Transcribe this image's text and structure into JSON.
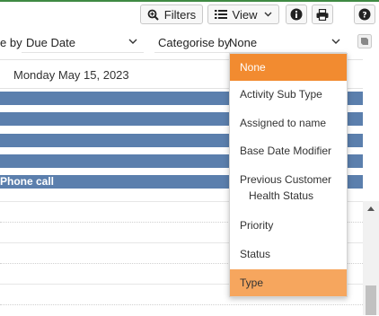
{
  "toolbar": {
    "filters_label": "Filters",
    "view_label": "View"
  },
  "controls": {
    "sort_prefix": "e by",
    "sort_value": "Due Date",
    "categorise_label": "Categorise by",
    "categorise_value": "None"
  },
  "calendar": {
    "date_header": "Monday May 15, 2023",
    "event_label": "Phone call"
  },
  "dropdown": {
    "items": [
      {
        "label": "None",
        "state": "selected"
      },
      {
        "label": "Activity Sub Type"
      },
      {
        "label": "Assigned to name"
      },
      {
        "label": "Base Date Modifier"
      },
      {
        "label": "Previous Customer",
        "label2": "Health Status"
      },
      {
        "label": "Priority"
      },
      {
        "label": "Status"
      },
      {
        "label": "Type",
        "state": "hover"
      }
    ]
  },
  "colors": {
    "event_bar": "#5b7fad",
    "selected_item": "#f28b30",
    "hover_item": "#f6a65e",
    "top_accent": "#3f8a43"
  },
  "icons": [
    "search-plus-icon",
    "list-icon",
    "chevron-down-icon",
    "info-icon",
    "print-icon",
    "help-icon",
    "book-icon"
  ]
}
